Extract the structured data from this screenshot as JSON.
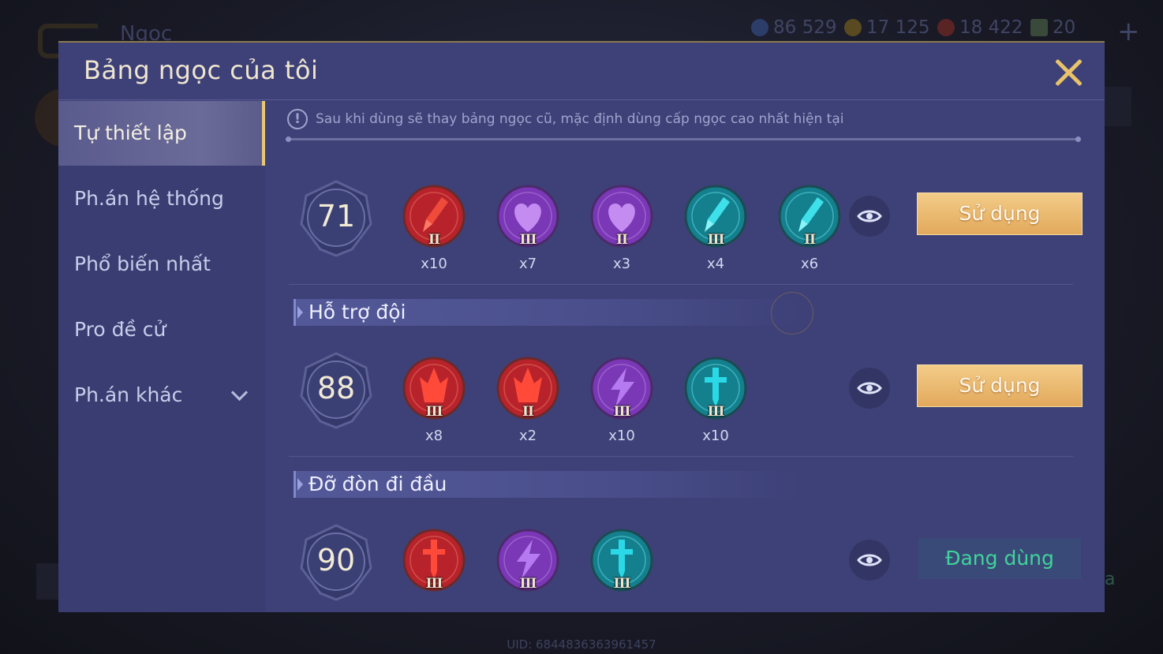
{
  "background": {
    "screen_title": "Ngọc",
    "currencies": [
      {
        "icon": "diamond-coin-icon",
        "value": "86 529"
      },
      {
        "icon": "gold-coin-icon",
        "value": "17 125"
      },
      {
        "icon": "ruby-icon",
        "value": "18 422"
      },
      {
        "icon": "card-icon",
        "value": "20"
      }
    ],
    "uid": "UID: 6844836363961457",
    "right_partial_text": "a"
  },
  "modal": {
    "title": "Bảng ngọc của tôi",
    "notice": "Sau khi dùng sẽ thay bảng ngọc cũ, mặc định dùng cấp ngọc cao nhất hiện tại"
  },
  "sidebar": {
    "items": [
      {
        "label": "Tự thiết lập",
        "active": true
      },
      {
        "label": "Ph.án hệ thống",
        "active": false
      },
      {
        "label": "Phổ biến nhất",
        "active": false
      },
      {
        "label": "Pro đề cử",
        "active": false
      },
      {
        "label": "Ph.án khác",
        "active": false
      }
    ]
  },
  "rows": [
    {
      "level": "71",
      "button": "Sử dụng",
      "gems": [
        {
          "icon": "red-sword-gem-icon",
          "color": "#b8232b",
          "tier": "II",
          "count": "x10"
        },
        {
          "icon": "purple-heart-gem-icon",
          "color": "#7a38b6",
          "tier": "III",
          "count": "x7"
        },
        {
          "icon": "purple-heart-gem-icon",
          "color": "#7a38b6",
          "tier": "II",
          "count": "x3"
        },
        {
          "icon": "teal-sword-gem-icon",
          "color": "#14808e",
          "tier": "III",
          "count": "x4"
        },
        {
          "icon": "teal-sword-gem-icon",
          "color": "#14808e",
          "tier": "II",
          "count": "x6"
        }
      ]
    },
    {
      "section": "Hỗ trợ đội",
      "level": "88",
      "button": "Sử dụng",
      "gems": [
        {
          "icon": "red-flame-gem-icon",
          "color": "#b8232b",
          "tier": "III",
          "count": "x8"
        },
        {
          "icon": "red-flame-gem-icon",
          "color": "#b8232b",
          "tier": "II",
          "count": "x2"
        },
        {
          "icon": "purple-lightning-gem-icon",
          "color": "#7a38b6",
          "tier": "III",
          "count": "x10"
        },
        {
          "icon": "teal-dagger-gem-icon",
          "color": "#14808e",
          "tier": "III",
          "count": "x10"
        }
      ]
    },
    {
      "section": "Đỡ đòn đi đầu",
      "level": "90",
      "button": "Đang dùng",
      "gems": [
        {
          "icon": "red-dagger-gem-icon",
          "color": "#b8232b",
          "tier": "III",
          "count": ""
        },
        {
          "icon": "purple-lightning-gem-icon",
          "color": "#7a38b6",
          "tier": "III",
          "count": ""
        },
        {
          "icon": "teal-dagger-gem-icon",
          "color": "#14808e",
          "tier": "III",
          "count": ""
        }
      ]
    }
  ],
  "colors": {
    "accent_gold": "#e6c774",
    "in_use_green": "#3fd49a",
    "modal_bg": "#3e4178"
  }
}
